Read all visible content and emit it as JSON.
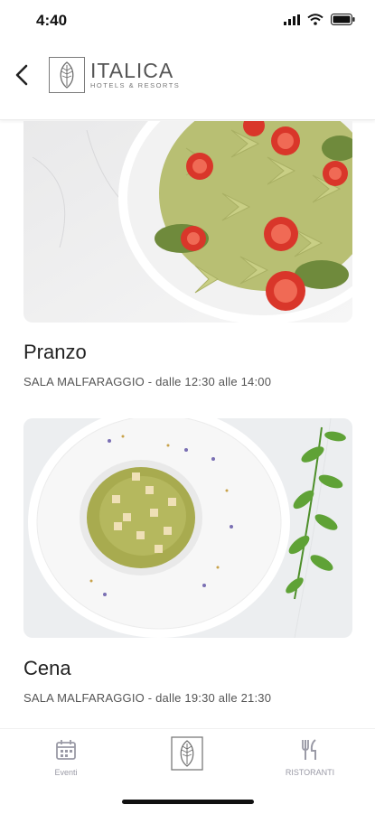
{
  "status_bar": {
    "time": "4:40"
  },
  "header": {
    "brand": "ITALICA",
    "brand_sub": "HOTELS & RESORTS"
  },
  "cards": [
    {
      "title": "Pranzo",
      "subtitle": "SALA MALFARAGGIO - dalle 12:30 alle 14:00"
    },
    {
      "title": "Cena",
      "subtitle": "SALA MALFARAGGIO - dalle 19:30 alle 21:30"
    }
  ],
  "tabbar": {
    "events_label": "Eventi",
    "restaurants_label": "RISTORANTI"
  },
  "colors": {
    "accent_gray": "#9a9aa6",
    "text": "#222222",
    "pesto": "#b6c06a"
  }
}
